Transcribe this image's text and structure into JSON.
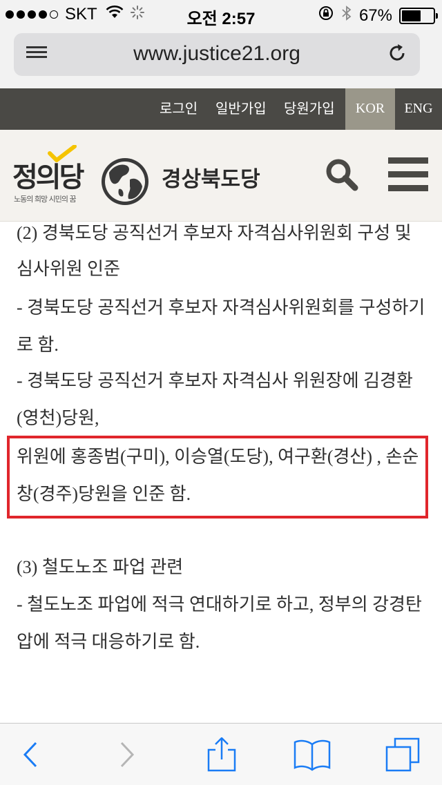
{
  "status_bar": {
    "carrier": "SKT",
    "time": "오전 2:57",
    "battery_percent_text": "67%",
    "battery_level": 0.67
  },
  "browser": {
    "url": "www.justice21.org"
  },
  "site_nav": {
    "links": [
      "로그인",
      "일반가입",
      "당원가입"
    ],
    "lang_kor": "KOR",
    "lang_eng": "ENG"
  },
  "header": {
    "logo_text": "정의당",
    "logo_slogan": "노동의 희망 시민의 꿈",
    "region_name": "경상북도당"
  },
  "content": {
    "lines": [
      "(2) 경북도당 공직선거 후보자 자격심사위원회 구성 및",
      "심사위원 인준",
      "- 경북도당 공직선거 후보자 자격심사위원회를 구성하기",
      "로 함.",
      "- 경북도당 공직선거 후보자 자격심사 위원장에 김경환",
      "(영천)당원,",
      "위원에 홍종범(구미), 이승열(도당), 여구환(경산) , 손순",
      "창(경주)당원을 인준 함.",
      "(3) 철도노조 파업 관련",
      "- 철도노조 파업에 적극 연대하기로 하고, 정부의 강경탄",
      "압에 적극 대응하기로 함."
    ]
  },
  "colors": {
    "nav_bg": "#4a4945",
    "kor_active_bg": "#9a978a",
    "highlight_border": "#e0262c",
    "ios_blue": "#1a7cf5"
  }
}
